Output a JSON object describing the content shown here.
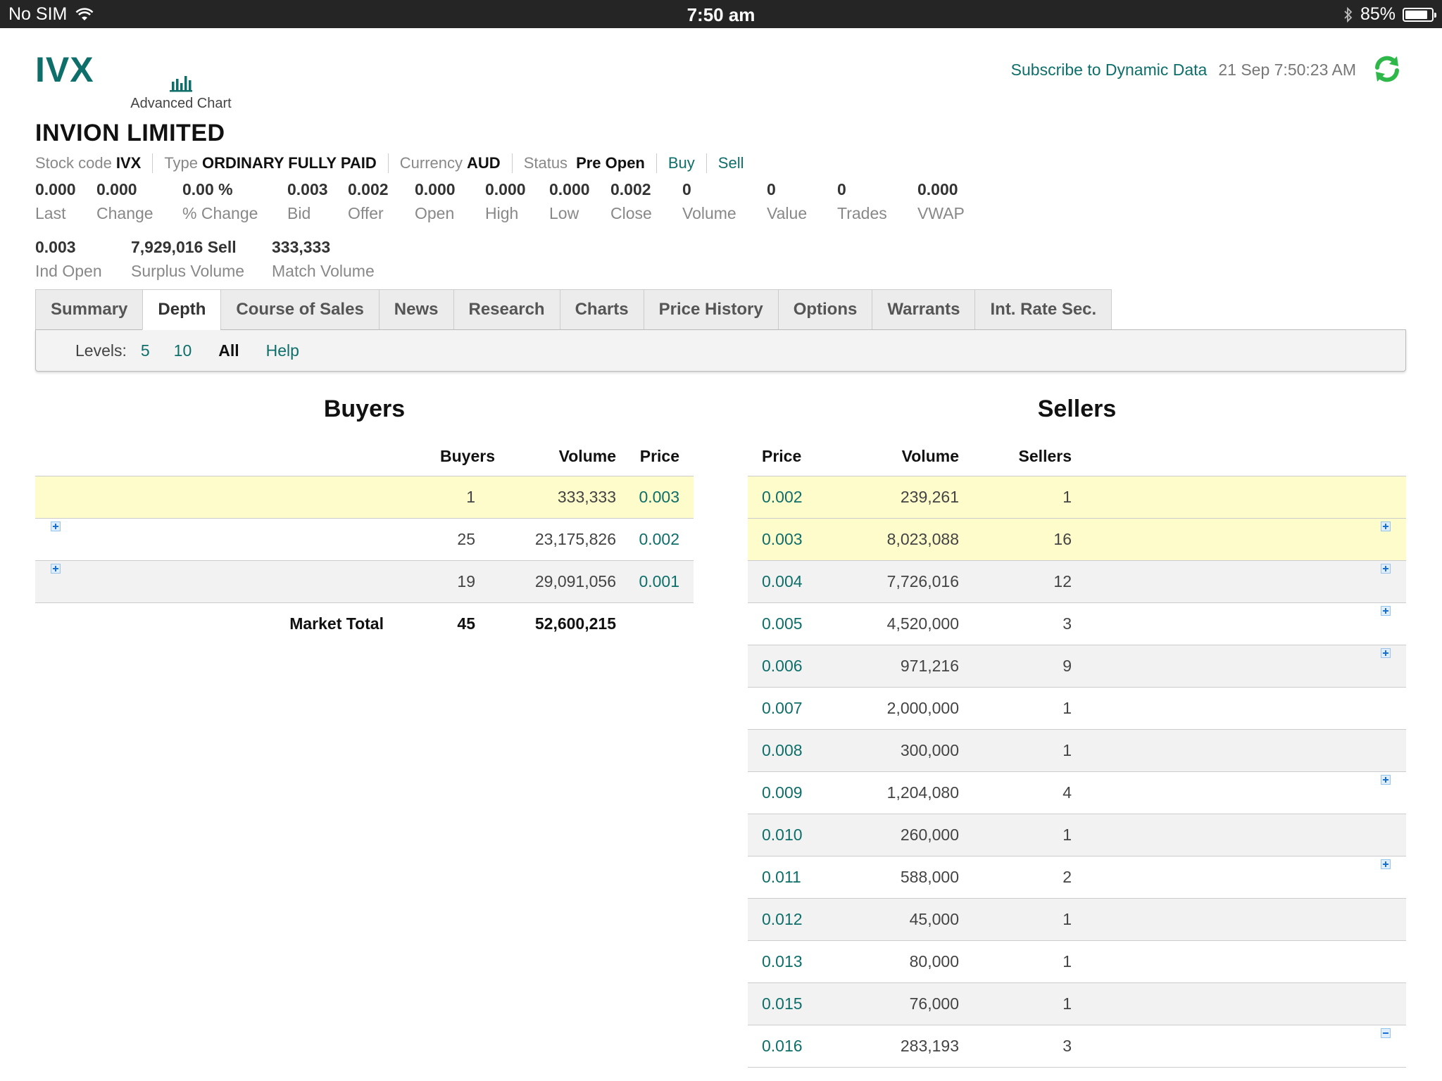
{
  "status_bar": {
    "carrier": "No SIM",
    "time": "7:50 am",
    "battery": "85%",
    "battery_level": 0.85
  },
  "header": {
    "ticker": "IVX",
    "advanced_chart_label": "Advanced Chart",
    "subscribe_label": "Subscribe to Dynamic Data",
    "timestamp": "21 Sep 7:50:23 AM",
    "company_name": "INVION LIMITED"
  },
  "meta": {
    "stock_code_label": "Stock code",
    "stock_code": "IVX",
    "type_label": "Type",
    "type": "ORDINARY FULLY PAID",
    "currency_label": "Currency",
    "currency": "AUD",
    "status_label": "Status",
    "status": "Pre Open",
    "buy_label": "Buy",
    "sell_label": "Sell"
  },
  "stats": [
    {
      "value": "0.000",
      "label": "Last"
    },
    {
      "value": "0.000",
      "label": "Change"
    },
    {
      "value": "0.00 %",
      "label": "% Change"
    },
    {
      "value": "0.003",
      "label": "Bid"
    },
    {
      "value": "0.002",
      "label": "Offer"
    },
    {
      "value": "0.000",
      "label": "Open"
    },
    {
      "value": "0.000",
      "label": "High"
    },
    {
      "value": "0.000",
      "label": "Low"
    },
    {
      "value": "0.002",
      "label": "Close"
    },
    {
      "value": "0",
      "label": "Volume"
    },
    {
      "value": "0",
      "label": "Value"
    },
    {
      "value": "0",
      "label": "Trades"
    },
    {
      "value": "0.000",
      "label": "VWAP"
    }
  ],
  "stats2": [
    {
      "value": "0.003",
      "label": "Ind Open"
    },
    {
      "value": "7,929,016 Sell",
      "label": "Surplus Volume"
    },
    {
      "value": "333,333",
      "label": "Match Volume"
    }
  ],
  "tabs": [
    "Summary",
    "Depth",
    "Course of Sales",
    "News",
    "Research",
    "Charts",
    "Price History",
    "Options",
    "Warrants",
    "Int. Rate Sec."
  ],
  "levels": {
    "label": "Levels:",
    "five": "5",
    "ten": "10",
    "all": "All",
    "help": "Help"
  },
  "buyers": {
    "title": "Buyers",
    "headers": {
      "buyers": "Buyers",
      "volume": "Volume",
      "price": "Price"
    },
    "rows": [
      {
        "buyers": "1",
        "volume": "333,333",
        "price": "0.003"
      },
      {
        "buyers": "25",
        "volume": "23,175,826",
        "price": "0.002"
      },
      {
        "buyers": "19",
        "volume": "29,091,056",
        "price": "0.001"
      }
    ],
    "total": {
      "label": "Market Total",
      "buyers": "45",
      "volume": "52,600,215"
    }
  },
  "sellers": {
    "title": "Sellers",
    "headers": {
      "price": "Price",
      "volume": "Volume",
      "sellers": "Sellers"
    },
    "rows": [
      {
        "price": "0.002",
        "volume": "239,261",
        "sellers": "1"
      },
      {
        "price": "0.003",
        "volume": "8,023,088",
        "sellers": "16"
      },
      {
        "price": "0.004",
        "volume": "7,726,016",
        "sellers": "12"
      },
      {
        "price": "0.005",
        "volume": "4,520,000",
        "sellers": "3"
      },
      {
        "price": "0.006",
        "volume": "971,216",
        "sellers": "9"
      },
      {
        "price": "0.007",
        "volume": "2,000,000",
        "sellers": "1"
      },
      {
        "price": "0.008",
        "volume": "300,000",
        "sellers": "1"
      },
      {
        "price": "0.009",
        "volume": "1,204,080",
        "sellers": "4"
      },
      {
        "price": "0.010",
        "volume": "260,000",
        "sellers": "1"
      },
      {
        "price": "0.011",
        "volume": "588,000",
        "sellers": "2"
      },
      {
        "price": "0.012",
        "volume": "45,000",
        "sellers": "1"
      },
      {
        "price": "0.013",
        "volume": "80,000",
        "sellers": "1"
      },
      {
        "price": "0.015",
        "volume": "76,000",
        "sellers": "1"
      },
      {
        "price": "0.016",
        "volume": "283,193",
        "sellers": "3"
      }
    ]
  },
  "colors": {
    "accent": "#0e6f6a",
    "highlight_row": "#fefccb",
    "alt_row": "#f2f2f2",
    "refresh_green": "#2fb84a"
  }
}
